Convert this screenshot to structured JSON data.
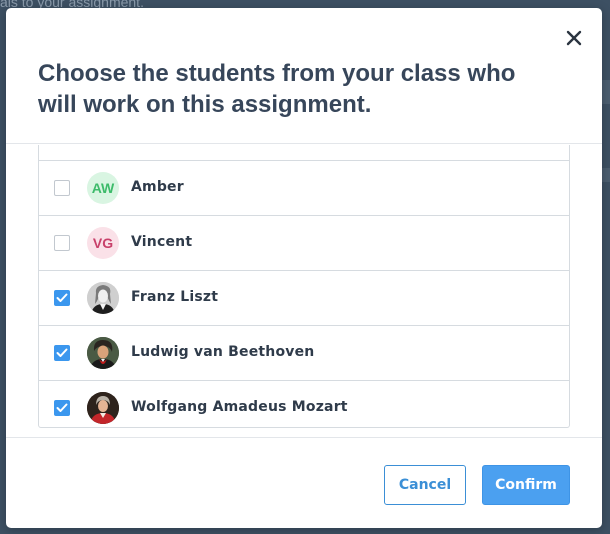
{
  "backdrop": {
    "text": "als to your assignment."
  },
  "modal": {
    "title": "Choose the students from your class who will work on this assignment.",
    "close_icon": "close-icon"
  },
  "students": [
    {
      "name": "Amber",
      "initials": "AW",
      "checked": false,
      "avatar_type": "initials",
      "avatar_bg": "#d9f5e2",
      "avatar_fg": "#3dbb6a"
    },
    {
      "name": "Vincent",
      "initials": "VG",
      "checked": false,
      "avatar_type": "initials",
      "avatar_bg": "#fae1e8",
      "avatar_fg": "#c8406a"
    },
    {
      "name": "Franz Liszt",
      "checked": true,
      "avatar_type": "photo",
      "avatar_icon": "portrait-liszt-icon"
    },
    {
      "name": "Ludwig van Beethoven",
      "checked": true,
      "avatar_type": "photo",
      "avatar_icon": "portrait-beethoven-icon"
    },
    {
      "name": "Wolfgang Amadeus Mozart",
      "checked": true,
      "avatar_type": "photo",
      "avatar_icon": "portrait-mozart-icon"
    }
  ],
  "footer": {
    "cancel_label": "Cancel",
    "confirm_label": "Confirm"
  },
  "colors": {
    "accent": "#4ba0f0",
    "checkbox_checked": "#3b97ee",
    "title_text": "#37465a",
    "backdrop": "#3d5063"
  }
}
